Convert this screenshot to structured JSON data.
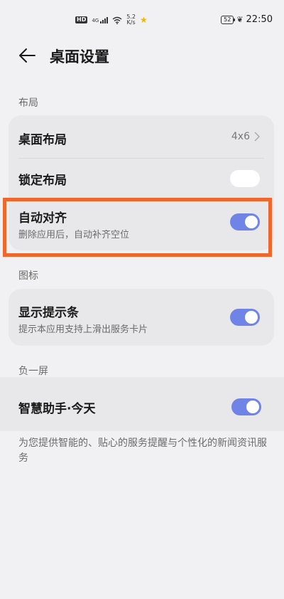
{
  "status_bar": {
    "hd": "HD",
    "network": "4G",
    "speed_value": "5.2",
    "speed_unit": "K/s",
    "battery": "52",
    "time": "22:50"
  },
  "header": {
    "title": "桌面设置"
  },
  "sections": {
    "layout": {
      "label": "布局",
      "desktop_layout": {
        "title": "桌面布局",
        "value": "4x6"
      },
      "lock_layout": {
        "title": "锁定布局",
        "enabled": false
      },
      "auto_align": {
        "title": "自动对齐",
        "subtitle": "删除应用后，自动补齐空位",
        "enabled": true
      }
    },
    "badges": {
      "label": "图标",
      "show_badge": {
        "title": "显示提示条",
        "subtitle": "提示本应用支持上滑出服务卡片",
        "enabled": true
      }
    },
    "minus_one": {
      "label": "负一屏",
      "smart_assistant": {
        "title": "智慧助手·今天",
        "enabled": true
      },
      "description": "为您提供智能的、贴心的服务提醒与个性化的新闻资讯服务"
    }
  },
  "colors": {
    "accent": "#6f84e6",
    "highlight": "#f0672e"
  }
}
